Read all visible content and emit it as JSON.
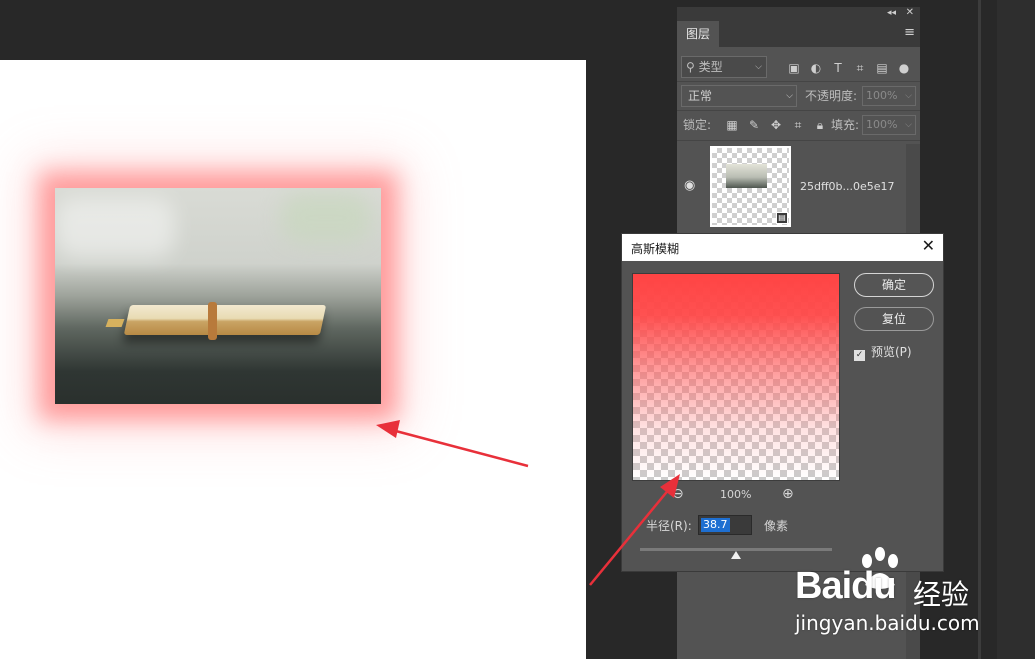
{
  "layers_panel": {
    "tab_label": "图层",
    "filter_placeholder": "类型",
    "blend_mode": "正常",
    "opacity_label": "不透明度:",
    "opacity_value": "100%",
    "lock_label": "锁定:",
    "fill_label": "填充:",
    "fill_value": "100%",
    "layer_name": "25dff0b...0e5e17"
  },
  "dialog": {
    "title": "高斯模糊",
    "ok_label": "确定",
    "reset_label": "复位",
    "preview_label": "预览(P)",
    "preview_checked": true,
    "zoom_value": "100%",
    "radius_label": "半径(R):",
    "radius_value": "38.7",
    "radius_unit": "像素"
  },
  "watermark": {
    "logo_text": "Baidu",
    "suffix": "经验",
    "url": "jingyan.baidu.com"
  },
  "colors": {
    "workspace": "#282828",
    "panel": "#535353",
    "glow": "#ff5f5f",
    "arrow": "#e8303a"
  }
}
